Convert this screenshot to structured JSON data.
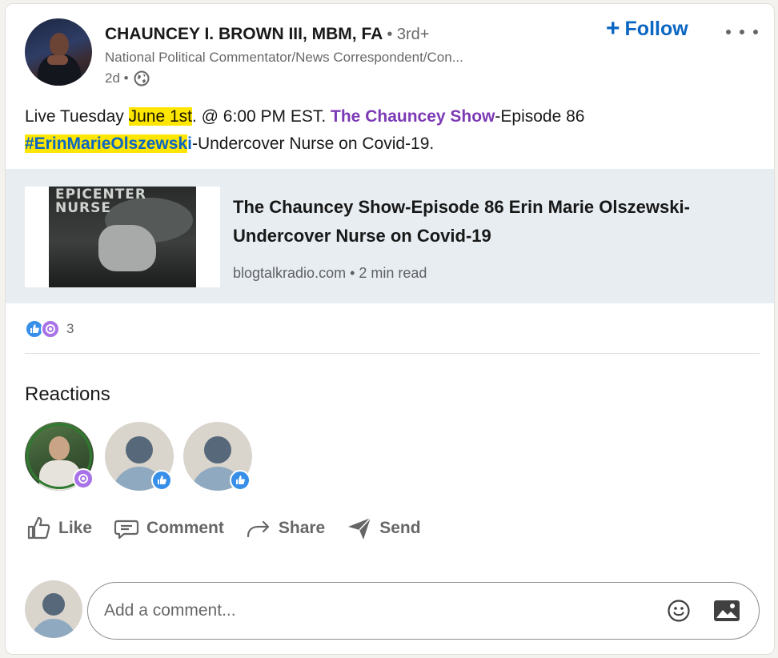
{
  "author": {
    "name": "CHAUNCEY I. BROWN III, MBM, FA",
    "degree": "• 3rd+",
    "headline": "National Political Commentator/News Correspondent/Con...",
    "time": "2d •"
  },
  "header": {
    "follow_plus": "+",
    "follow_label": "Follow"
  },
  "post": {
    "text_1": "Live Tuesday ",
    "date_highlight": "June 1st",
    "text_2": ". @ 6:00 PM EST. ",
    "mention": "The Chauncey Show",
    "text_3": "-Episode 86",
    "hashtag": "#ErinMarieOlszewsk",
    "hashtag_tail": "i",
    "text_4": "-Undercover Nurse on Covid-19."
  },
  "link_preview": {
    "thumb_title_line1": "EPICENTER",
    "thumb_title_line2": "NURSE",
    "title": "The Chauncey Show-Episode 86 Erin Marie Olszewski-Undercover Nurse on Covid-19",
    "source": "blogtalkradio.com • 2 min read"
  },
  "social": {
    "reaction_count": "3"
  },
  "reactions": {
    "heading": "Reactions"
  },
  "actions": {
    "like": "Like",
    "comment": "Comment",
    "share": "Share",
    "send": "Send"
  },
  "comment_box": {
    "placeholder": "Add a comment..."
  },
  "colors": {
    "brand_blue": "#0a66c2",
    "mention_purple": "#7c3ab5",
    "highlight_yellow": "#ffe600",
    "like_blue": "#378fe9",
    "curious_purple": "#a872e8"
  }
}
